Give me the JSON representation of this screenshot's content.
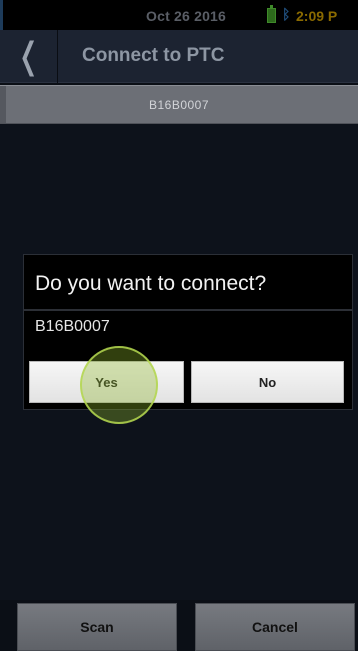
{
  "status_bar": {
    "date": "Oct 26 2016",
    "time": "2:09 P",
    "battery_icon": "battery-icon",
    "bluetooth_icon": "bluetooth-icon"
  },
  "header": {
    "back_icon": "chevron-left-icon",
    "back_glyph": "❬",
    "title": "Connect to PTC"
  },
  "device_bar": {
    "label": "B16B0007"
  },
  "dialog": {
    "title": "Do you want to connect?",
    "message": "B16B0007",
    "yes_label": "Yes",
    "no_label": "No"
  },
  "bottom_bar": {
    "scan_label": "Scan",
    "cancel_label": "Cancel"
  },
  "colors": {
    "background": "#0b0f16",
    "header": "#1c2331",
    "touch_highlight": "#b4d750"
  }
}
